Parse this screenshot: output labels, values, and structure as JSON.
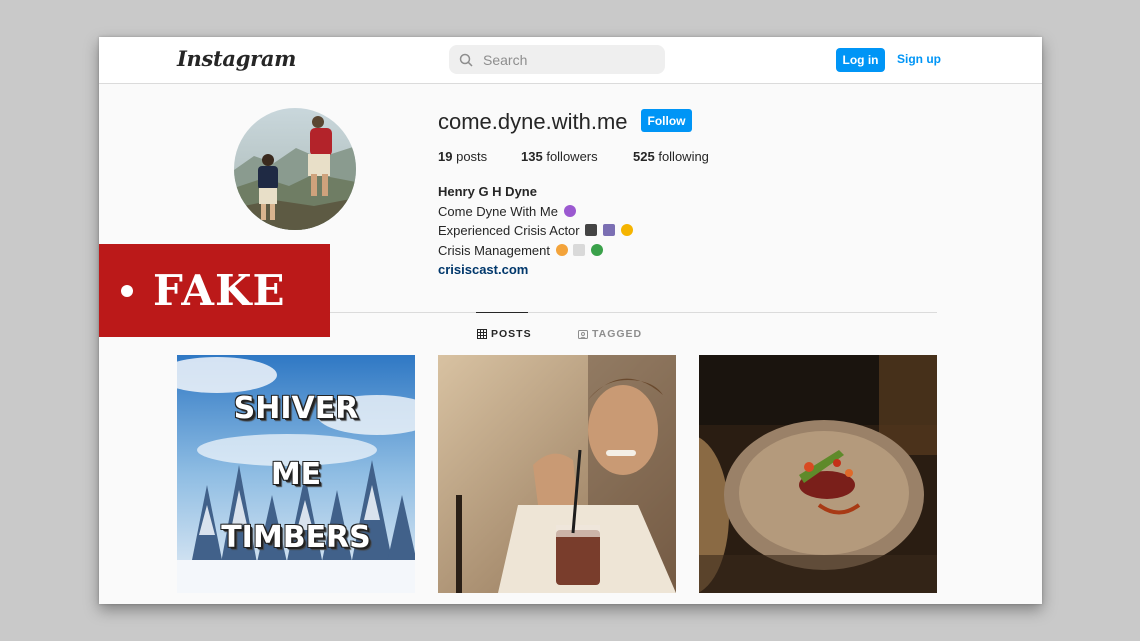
{
  "app": {
    "logo": "Instagram"
  },
  "header": {
    "search_placeholder": "Search",
    "login_label": "Log in",
    "signup_label": "Sign up"
  },
  "profile": {
    "username": "come.dyne.with.me",
    "follow_label": "Follow",
    "posts_count": "19",
    "posts_label": "posts",
    "followers_count": "135",
    "followers_label": "followers",
    "following_count": "525",
    "following_label": "following",
    "full_name": "Henry G H Dyne",
    "bio_line1": "Come Dyne With Me",
    "bio_line2": "Experienced Crisis Actor",
    "bio_line3": "Crisis Management",
    "website": "crisiscast.com"
  },
  "tabs": [
    {
      "label": "POSTS",
      "icon": "grid-icon",
      "active": true
    },
    {
      "label": "TAGGED",
      "icon": "tag-icon",
      "active": false
    }
  ],
  "posts": [
    {
      "kind": "meme",
      "lines": [
        "SHIVER",
        "ME",
        "TIMBERS"
      ]
    },
    {
      "kind": "photo",
      "subject": "smiling man with drink"
    },
    {
      "kind": "photo",
      "subject": "plated steak dish"
    }
  ],
  "overlay": {
    "label": "FAKE"
  },
  "colors": {
    "accent": "#0095f6",
    "link": "#00376b",
    "fake_red": "#bb1919",
    "emoji_purple_heart": "#9b59d0"
  }
}
